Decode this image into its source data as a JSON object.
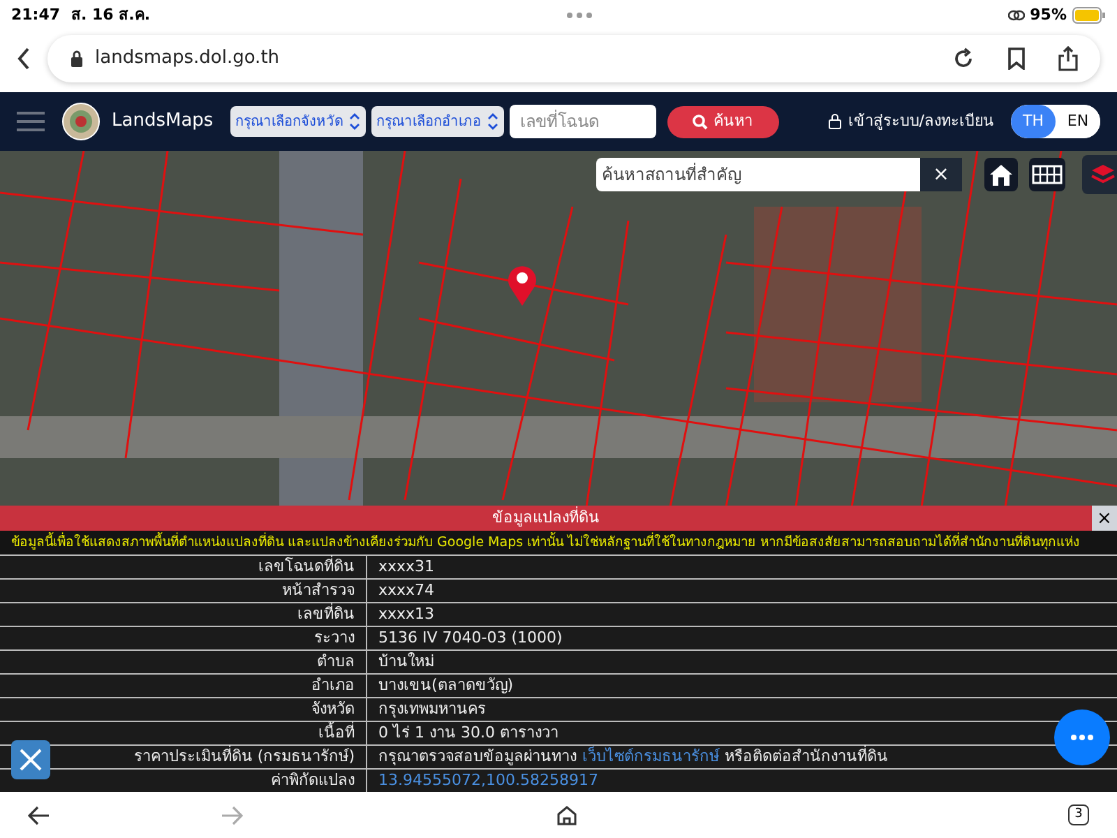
{
  "status_bar": {
    "time": "21:47",
    "date": "ส. 16 ส.ค.",
    "battery": "95%"
  },
  "browser": {
    "url": "landsmaps.dol.go.th"
  },
  "navbar": {
    "brand": "LandsMaps",
    "province_select": "กรุณาเลือกจังหวัด",
    "district_select": "กรุณาเลือกอำเภอ",
    "deed_field": {
      "placeholder": "เลขที่โฉนด"
    },
    "search_button": "ค้นหา",
    "login": "เข้าสู่ระบบ/ลงทะเบียน",
    "languages": [
      {
        "label": "TH",
        "selected": true
      },
      {
        "label": "EN",
        "selected": false
      }
    ]
  },
  "map": {
    "search": {
      "placeholder": "ค้นหาสถานที่สำคัญ"
    },
    "clear": "×"
  },
  "info_panel": {
    "title": "ข้อมูลแปลงที่ดิน",
    "close": "×",
    "disclaimer": "ข้อมูลนี้เพื่อใช้แสดงสภาพพื้นที่ตำแหน่งแปลงที่ดิน และแปลงข้างเคียงร่วมกับ Google Maps เท่านั้น ไม่ใช่หลักฐานที่ใช้ในทางกฎหมาย หากมีข้อสงสัยสามารถสอบถามได้ที่สำนักงานที่ดินทุกแห่ง",
    "rows": [
      {
        "label": "เลขโฉนดที่ดิน",
        "value": [
          {
            "kind": "text",
            "text": "xxxx31"
          }
        ]
      },
      {
        "label": "หน้าสำรวจ",
        "value": [
          {
            "kind": "text",
            "text": "xxxx74"
          }
        ]
      },
      {
        "label": "เลขที่ดิน",
        "value": [
          {
            "kind": "text",
            "text": "xxxx13"
          }
        ]
      },
      {
        "label": "ระวาง",
        "value": [
          {
            "kind": "text",
            "text": "5136 IV 7040-03 (1000)"
          }
        ]
      },
      {
        "label": "ตำบล",
        "value": [
          {
            "kind": "text",
            "text": "บ้านใหม่"
          }
        ]
      },
      {
        "label": "อำเภอ",
        "value": [
          {
            "kind": "text",
            "text": "บางเขน(ตลาดขวัญ)"
          }
        ]
      },
      {
        "label": "จังหวัด",
        "value": [
          {
            "kind": "text",
            "text": "กรุงเทพมหานคร"
          }
        ]
      },
      {
        "label": "เนื้อที่",
        "value": [
          {
            "kind": "text",
            "text": "0 ไร่ 1 งาน 30.0 ตารางวา"
          }
        ]
      },
      {
        "label": "ราคาประเมินที่ดิน (กรมธนารักษ์)",
        "value": [
          {
            "kind": "text",
            "text": "กรุณาตรวจสอบข้อมูลผ่านทาง"
          },
          {
            "kind": "link",
            "text": "เว็บไซต์กรมธนารักษ์"
          },
          {
            "kind": "text",
            "text": "หรือติดต่อสำนักงานที่ดิน"
          }
        ]
      },
      {
        "label": "ค่าพิกัดแปลง",
        "value": [
          {
            "kind": "link",
            "text": "13.94555072,100.58258917"
          }
        ]
      }
    ]
  },
  "bottom_bar": {
    "tabs_count": "3"
  }
}
